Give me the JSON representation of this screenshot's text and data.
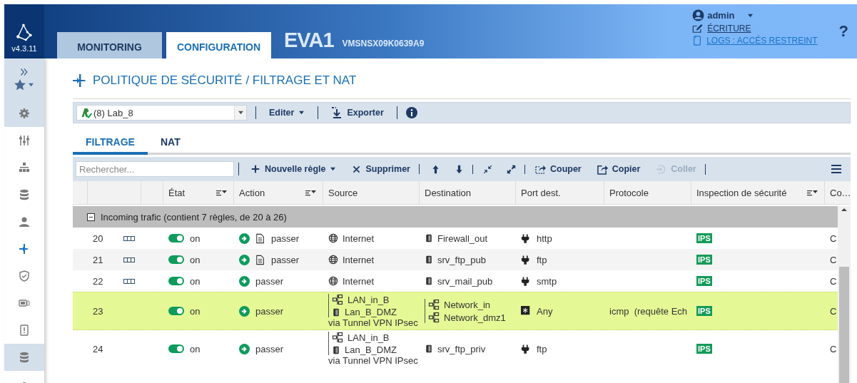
{
  "header": {
    "version": "v4.3.11",
    "tabs": [
      {
        "label": "MONITORING",
        "selected": false
      },
      {
        "label": "CONFIGURATION",
        "selected": true
      }
    ],
    "device_name": "EVA1",
    "serial": "VMSNSX09K0639A9",
    "user": "admin",
    "links": [
      {
        "label": "ÉCRITURE",
        "kind": "write"
      },
      {
        "label": "LOGS : ACCÉS RESTREINT",
        "kind": "logs"
      }
    ],
    "help": "?"
  },
  "sidebar": {
    "items": [
      {
        "kind": "favorites",
        "selected": false
      },
      {
        "kind": "section",
        "selected": false
      },
      {
        "kind": "item",
        "selected": false
      },
      {
        "kind": "item",
        "selected": false
      },
      {
        "kind": "item",
        "selected": false
      },
      {
        "kind": "item",
        "selected": false
      },
      {
        "kind": "item",
        "selected": true
      },
      {
        "kind": "item",
        "selected": false
      },
      {
        "kind": "item",
        "selected": false
      },
      {
        "kind": "item",
        "selected": false
      },
      {
        "kind": "section",
        "selected": false
      },
      {
        "kind": "item",
        "selected": false
      }
    ]
  },
  "page": {
    "title": "POLITIQUE DE SÉCURITÉ / FILTRAGE ET NAT"
  },
  "policy_bar": {
    "policy": "(8) Lab_8",
    "buttons": [
      {
        "label": "Editer",
        "dropdown": true
      },
      {
        "label": "Exporter",
        "dropdown": false
      }
    ]
  },
  "tabs": [
    {
      "label": "FILTRAGE",
      "selected": true
    },
    {
      "label": "NAT",
      "selected": false
    }
  ],
  "rule_toolbar": {
    "search_placeholder": "Rechercher...",
    "buttons": [
      {
        "label": "Nouvelle règle",
        "dropdown": true,
        "disabled": false,
        "separator_after": false
      },
      {
        "label": "Supprimer",
        "dropdown": false,
        "disabled": false,
        "separator_after": true
      },
      {
        "dropdown": false,
        "disabled": false,
        "separator_after": false
      },
      {
        "dropdown": false,
        "disabled": false,
        "separator_after": true
      },
      {
        "dropdown": false,
        "disabled": false,
        "separator_after": false
      },
      {
        "dropdown": false,
        "disabled": false,
        "separator_after": true
      },
      {
        "label": "Couper",
        "dropdown": false,
        "disabled": false,
        "separator_after": false
      },
      {
        "label": "Copier",
        "dropdown": false,
        "disabled": false,
        "separator_after": false
      },
      {
        "label": "Coller",
        "dropdown": false,
        "disabled": true,
        "separator_after": true
      }
    ]
  },
  "table": {
    "columns": [
      {
        "label": "État",
        "sortable": true
      },
      {
        "label": "Action",
        "sortable": true
      },
      {
        "label": "Source",
        "sortable": false
      },
      {
        "label": "Destination",
        "sortable": false
      },
      {
        "label": "Port dest.",
        "sortable": false
      },
      {
        "label": "Protocole",
        "sortable": false
      },
      {
        "label": "Inspection de sécurité",
        "sortable": true
      },
      {
        "label": "Co…",
        "sortable": false
      }
    ],
    "group": {
      "label": "Incoming trafic (contient 7 règles, de 20 à 26)",
      "expanded": true
    },
    "rows": [
      {
        "number": "20",
        "flag": true,
        "enabled": true,
        "state": "on",
        "document": true,
        "action": "passer",
        "source": [
          {
            "kind": "internet",
            "label": "Internet"
          }
        ],
        "destination": [
          {
            "kind": "host",
            "label": "Firewall_out"
          }
        ],
        "port": {
          "kind": "service",
          "label": "http"
        },
        "inspection": "IPS",
        "comment": "C",
        "selected": false
      },
      {
        "number": "21",
        "flag": true,
        "enabled": true,
        "state": "on",
        "document": true,
        "action": "passer",
        "source": [
          {
            "kind": "internet",
            "label": "Internet"
          }
        ],
        "destination": [
          {
            "kind": "host",
            "label": "srv_ftp_pub"
          }
        ],
        "port": {
          "kind": "service",
          "label": "ftp"
        },
        "inspection": "IPS",
        "comment": "C",
        "selected": false
      },
      {
        "number": "22",
        "flag": true,
        "enabled": true,
        "state": "on",
        "document": false,
        "action": "passer",
        "source": [
          {
            "kind": "internet",
            "label": "Internet"
          }
        ],
        "destination": [
          {
            "kind": "host",
            "label": "srv_mail_pub"
          }
        ],
        "port": {
          "kind": "service",
          "label": "smtp"
        },
        "inspection": "IPS",
        "comment": "C",
        "selected": false
      },
      {
        "number": "23",
        "flag": false,
        "enabled": true,
        "state": "on",
        "document": false,
        "action": "passer",
        "source": [
          {
            "kind": "network",
            "label": "LAN_in_B"
          },
          {
            "kind": "host",
            "label": "Lan_B_DMZ"
          }
        ],
        "via": "via Tunnel VPN IPsec",
        "destination": [
          {
            "kind": "network",
            "label": "Network_in"
          },
          {
            "kind": "network",
            "label": "Network_dmz1"
          }
        ],
        "port": {
          "kind": "any",
          "label": "Any"
        },
        "protocol": "icmp  (requête Ech",
        "inspection": "IPS",
        "comment": "C",
        "selected": true
      },
      {
        "number": "24",
        "flag": false,
        "enabled": true,
        "state": "on",
        "document": false,
        "action": "passer",
        "source": [
          {
            "kind": "network",
            "label": "LAN_in_B"
          },
          {
            "kind": "host",
            "label": "Lan_B_DMZ"
          }
        ],
        "via": "via Tunnel VPN IPsec",
        "destination": [
          {
            "kind": "host",
            "label": "srv_ftp_priv"
          }
        ],
        "port": {
          "kind": "service",
          "label": "ftp"
        },
        "inspection": "IPS",
        "comment": "C",
        "selected": false
      }
    ]
  }
}
